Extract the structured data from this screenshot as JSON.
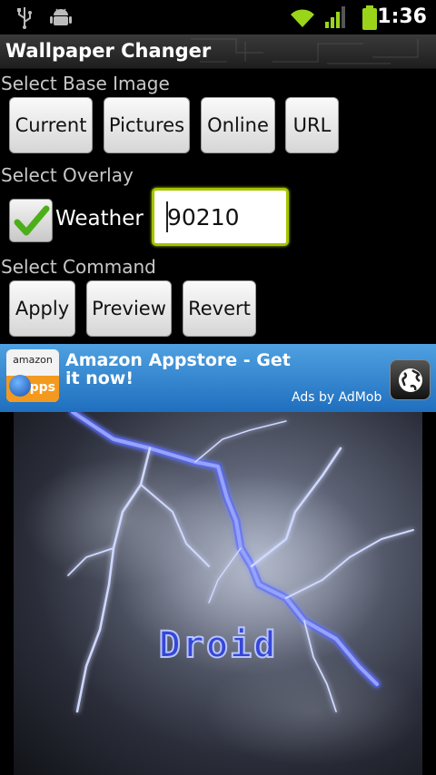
{
  "status_bar": {
    "time": "1:36",
    "icons": [
      "usb-icon",
      "android-debug-icon",
      "wifi-icon",
      "signal-icon",
      "battery-icon"
    ]
  },
  "app": {
    "title": "Wallpaper Changer"
  },
  "base_image": {
    "label": "Select Base Image",
    "buttons": [
      "Current",
      "Pictures",
      "Online",
      "URL"
    ]
  },
  "overlay": {
    "label": "Select Overlay",
    "weather_label": "Weather",
    "weather_checked": true,
    "zip_value": "90210"
  },
  "command": {
    "label": "Select Command",
    "buttons": [
      "Apply",
      "Preview",
      "Revert"
    ]
  },
  "ad": {
    "logo_top": "amazon",
    "logo_bottom": "apps",
    "text": "Amazon Appstore - Get it now!",
    "credit": "Ads by AdMob"
  },
  "preview": {
    "logo_text": "Droid"
  },
  "colors": {
    "accent_focus": "#a4c400",
    "ad_blue": "#2a7fcf",
    "check_green": "#4caf1a",
    "battery_green": "#9bd51a"
  }
}
